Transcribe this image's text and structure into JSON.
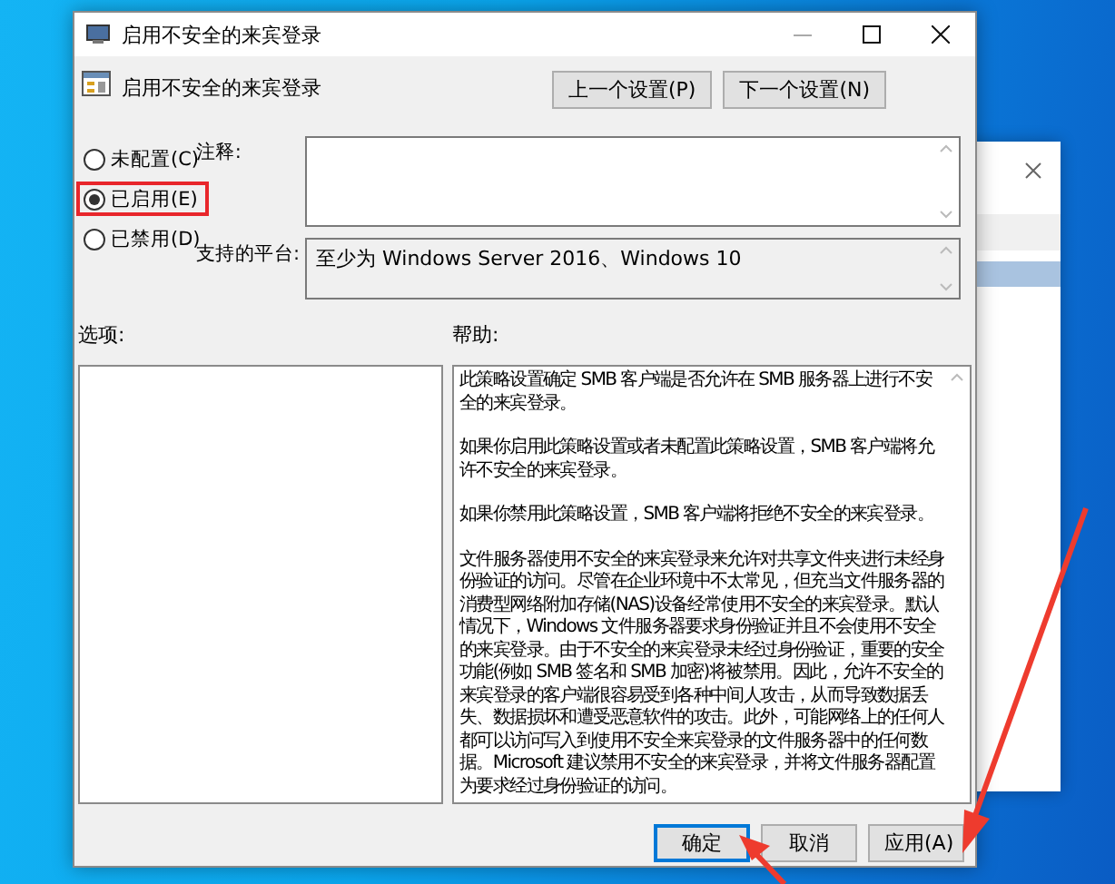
{
  "window": {
    "title": "启用不安全的来宾登录"
  },
  "header": {
    "title": "启用不安全的来宾登录",
    "buttons": [
      "上一个设置(P)",
      "下一个设置(N)"
    ]
  },
  "states": [
    {
      "label": "未配置(C)",
      "selected": false,
      "annotated": false
    },
    {
      "label": "已启用(E)",
      "selected": true,
      "annotated": true
    },
    {
      "label": "已禁用(D)",
      "selected": false,
      "annotated": false
    }
  ],
  "comment": {
    "label": "注释:"
  },
  "platform": {
    "label": "支持的平台:",
    "value": "至少为 Windows Server 2016、Windows 10"
  },
  "options": {
    "label": "选项:"
  },
  "help": {
    "label": "帮助:",
    "paragraphs": [
      "此策略设置确定 SMB 客户端是否允许在 SMB 服务器上进行不安全的来宾登录。",
      "如果你启用此策略设置或者未配置此策略设置，SMB 客户端将允许不安全的来宾登录。",
      "如果你禁用此策略设置，SMB 客户端将拒绝不安全的来宾登录。",
      "文件服务器使用不安全的来宾登录来允许对共享文件夹进行未经身份验证的访问。尽管在企业环境中不太常见，但充当文件服务器的消费型网络附加存储(NAS)设备经常使用不安全的来宾登录。默认情况下，Windows 文件服务器要求身份验证并且不会使用不安全的来宾登录。由于不安全的来宾登录未经过身份验证，重要的安全功能(例如 SMB 签名和 SMB 加密)将被禁用。因此，允许不安全的来宾登录的客户端很容易受到各种中间人攻击，从而导致数据丢失、数据损坏和遭受恶意软件的攻击。此外，可能网络上的任何人都可以访问写入到使用不安全来宾登录的文件服务器中的任何数据。Microsoft 建议禁用不安全的来宾登录，并将文件服务器配置为要求经过身份验证的访问。"
    ]
  },
  "footer": {
    "buttons": [
      {
        "label": "确定",
        "default": true
      },
      {
        "label": "取消",
        "default": false
      },
      {
        "label": "应用(A)",
        "default": false
      }
    ]
  }
}
